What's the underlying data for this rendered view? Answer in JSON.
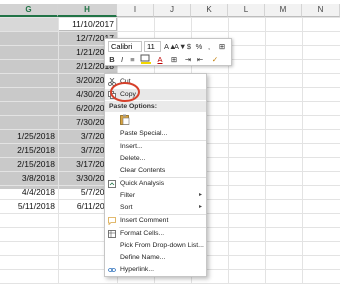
{
  "columns": [
    {
      "name": "G",
      "selected": true
    },
    {
      "name": "H",
      "selected": true
    },
    {
      "name": "I",
      "selected": false
    },
    {
      "name": "J",
      "selected": false
    },
    {
      "name": "K",
      "selected": false
    },
    {
      "name": "L",
      "selected": false
    },
    {
      "name": "M",
      "selected": false
    },
    {
      "name": "N",
      "selected": false
    }
  ],
  "col_g_values": [
    "",
    "",
    "",
    "",
    "",
    "",
    "",
    "",
    "1/25/2018",
    "2/15/2018",
    "2/15/2018",
    "3/8/2018",
    "4/4/2018",
    "5/11/2018"
  ],
  "col_h_values": [
    "11/10/2017",
    "12/7/2017",
    "1/21/2018",
    "2/12/2018",
    "3/20/2018",
    "4/30/2018",
    "6/20/2018",
    "7/30/2018",
    "3/7/2018",
    "3/7/2018",
    "3/17/2018",
    "3/30/2018",
    "5/7/2018",
    "6/11/2018"
  ],
  "minibar": {
    "font_name": "Calibri",
    "font_size": "11",
    "icons": [
      "A▲",
      "A▼",
      "$",
      "%",
      ",",
      "B",
      "I",
      "≡",
      "A",
      "⊞",
      "⇥",
      "⇤",
      "✓"
    ]
  },
  "menu": {
    "cut_label": "Cut",
    "copy_label": "Copy",
    "paste_header": "Paste Options:",
    "paste_special_label": "Paste Special...",
    "insert_label": "Insert...",
    "delete_label": "Delete...",
    "clear_contents_label": "Clear Contents",
    "quick_analysis_label": "Quick Analysis",
    "filter_label": "Filter",
    "sort_label": "Sort",
    "insert_comment_label": "Insert Comment",
    "format_cells_label": "Format Cells...",
    "pick_dropdown_label": "Pick From Drop-down List...",
    "define_name_label": "Define Name...",
    "hyperlink_label": "Hyperlink..."
  },
  "colors": {
    "accent": "#217346",
    "highlight_ring": "#d6402a",
    "selection": "#c9c9c9"
  }
}
